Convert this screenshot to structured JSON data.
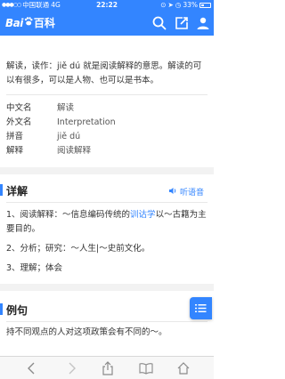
{
  "status": {
    "carrier": "中国联通",
    "network": "4G",
    "time": "22:22",
    "battery": "33%",
    "bar_color": "#3385ff"
  },
  "header": {
    "logo_bai": "Bai",
    "logo_ke": "百科",
    "icons": [
      "search-icon",
      "share-icon",
      "user-icon"
    ]
  },
  "intro": {
    "text": "解读，读作：jiě dú 就是阅读解释的意思。解读的可以有很多，可以是人物、也可以是书本。"
  },
  "info": [
    {
      "key": "中文名",
      "value": "解读"
    },
    {
      "key": "外文名",
      "value": "Interpretation"
    },
    {
      "key": "拼音",
      "value": "jiě dú"
    },
    {
      "key": "解释",
      "value": "阅读解释"
    }
  ],
  "detail_section": {
    "title": "详解",
    "listen_label": "听语音",
    "items": [
      {
        "before": "1、阅读解释：～信息编码传统的",
        "link": "训诂学",
        "after": "以～古籍为主要目的。"
      },
      {
        "text": "2、分析；研究：～人生|～史前文化。"
      },
      {
        "text": "3、理解；体会"
      }
    ]
  },
  "example_section": {
    "title": "例句",
    "items": [
      {
        "text": "持不同观点的人对这项政策会有不同的～。"
      }
    ]
  },
  "colors": {
    "accent": "#3385ff",
    "band": "#f2f2f2"
  }
}
